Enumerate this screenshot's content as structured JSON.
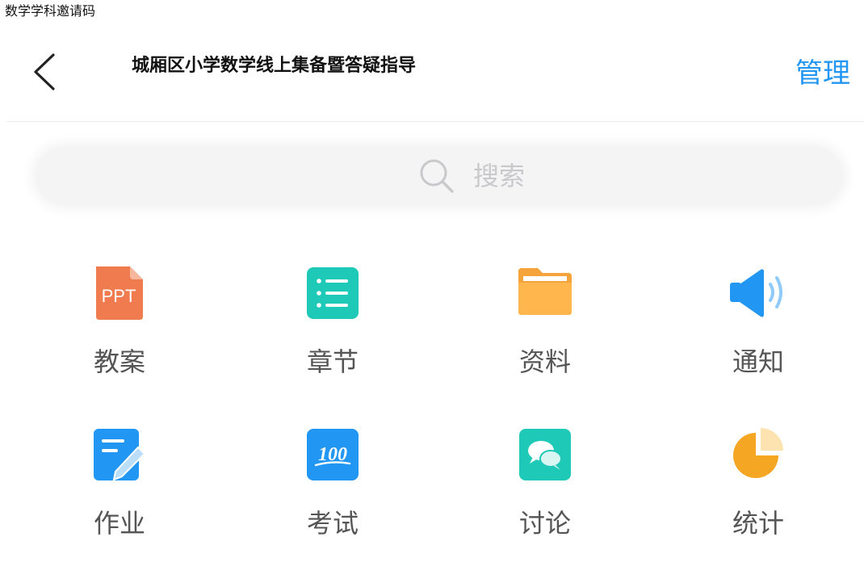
{
  "page": {
    "caption": "数学学科邀请码"
  },
  "navbar": {
    "title": "城厢区小学数学线上集备暨答疑指导",
    "manage_label": "管理"
  },
  "search": {
    "placeholder": "搜索"
  },
  "colors": {
    "accent": "#2196f3",
    "ppt_orange": "#f07b4f",
    "teal": "#1ec9b8",
    "folder_yellow": "#ffb74d",
    "speaker_blue": "#2196f3",
    "pie_orange": "#f5a623"
  },
  "grid": [
    {
      "label": "教案",
      "icon": "ppt-icon",
      "icon_text": "PPT"
    },
    {
      "label": "章节",
      "icon": "chapter-list-icon"
    },
    {
      "label": "资料",
      "icon": "folder-icon"
    },
    {
      "label": "通知",
      "icon": "speaker-icon"
    },
    {
      "label": "作业",
      "icon": "homework-edit-icon"
    },
    {
      "label": "考试",
      "icon": "exam-100-icon",
      "icon_text": "100"
    },
    {
      "label": "讨论",
      "icon": "discussion-bubbles-icon"
    },
    {
      "label": "统计",
      "icon": "pie-chart-icon"
    }
  ]
}
